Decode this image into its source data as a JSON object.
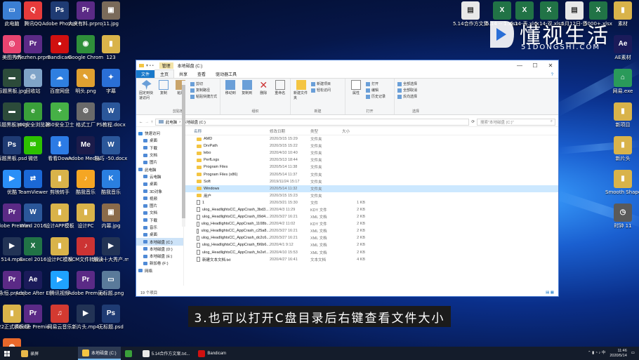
{
  "desktop_left": [
    {
      "label": "此电脑",
      "color": "#3b7fd4",
      "glyph": "▭"
    },
    {
      "label": "腾讯QQ",
      "color": "#e63b3b",
      "glyph": "Q"
    },
    {
      "label": "Adobe Photosh...",
      "color": "#1f3b73",
      "glyph": "Ps"
    },
    {
      "label": "大庆有料.prproj",
      "color": "#5b2a86",
      "glyph": "Pr"
    },
    {
      "label": "11.jpg",
      "color": "#7a6a5a",
      "glyph": "▣"
    },
    {
      "label": "美图秀秀",
      "color": "#e84470",
      "glyph": "◎"
    },
    {
      "label": "zhezhen.prproj",
      "color": "#5b2a86",
      "glyph": "Pr"
    },
    {
      "label": "Bandicam",
      "color": "#d01010",
      "glyph": "●"
    },
    {
      "label": "Google Chrome",
      "color": "#2f8f3a",
      "glyph": "◉"
    },
    {
      "label": "123",
      "color": "#d9b34a",
      "glyph": "▮"
    },
    {
      "label": "标题黑板.jpg",
      "color": "#2c4b3a",
      "glyph": "▬"
    },
    {
      "label": "回收站",
      "color": "#7fa3c8",
      "glyph": "♲"
    },
    {
      "label": "百度网盘",
      "color": "#2f7fe0",
      "glyph": "☁"
    },
    {
      "label": "明头.png",
      "color": "#e0a030",
      "glyph": "✎"
    },
    {
      "label": "字幕",
      "color": "#2a6fd6",
      "glyph": "✦"
    },
    {
      "label": "标题黑板.png",
      "color": "#2c4b3a",
      "glyph": "▬"
    },
    {
      "label": "360安全浏览器",
      "color": "#3aa03a",
      "glyph": "e"
    },
    {
      "label": "360安全卫士",
      "color": "#46b046",
      "glyph": "+"
    },
    {
      "label": "格式工厂",
      "color": "#6a6a6a",
      "glyph": "⚙"
    },
    {
      "label": "PS教程.docx",
      "color": "#2b579a",
      "glyph": "W"
    },
    {
      "label": "标题黑板.psd",
      "color": "#1f3b73",
      "glyph": "Ps"
    },
    {
      "label": "微信",
      "color": "#2dc100",
      "glyph": "✉"
    },
    {
      "label": "看看Down",
      "color": "#2c7be5",
      "glyph": "⬇"
    },
    {
      "label": "Adobe Media...",
      "color": "#1b1b4a",
      "glyph": "Me"
    },
    {
      "label": "技巧 -50.docx",
      "color": "#2b579a",
      "glyph": "W"
    },
    {
      "label": "优酷",
      "color": "#2a8ff7",
      "glyph": "▶"
    },
    {
      "label": "TeamViewer",
      "color": "#1b68d6",
      "glyph": "⇄"
    },
    {
      "label": "剪映转手",
      "color": "#d9b34a",
      "glyph": "▮"
    },
    {
      "label": "酷我音乐",
      "color": "#f5a623",
      "glyph": "♪"
    },
    {
      "label": "酷我音乐",
      "color": "#2a7fe0",
      "glyph": "K"
    },
    {
      "label": "Adobe Premier...",
      "color": "#5b2a86",
      "glyph": "Pr"
    },
    {
      "label": "Word 2016",
      "color": "#2b579a",
      "glyph": "W"
    },
    {
      "label": "设计APP模板",
      "color": "#d9b34a",
      "glyph": "▮"
    },
    {
      "label": "设计PC",
      "color": "#d9b34a",
      "glyph": "▮"
    },
    {
      "label": "内幕.jpg",
      "color": "#8a6a4a",
      "glyph": "▣"
    },
    {
      "label": "514.mp4",
      "color": "#223355",
      "glyph": "▶"
    },
    {
      "label": "Excel 2016",
      "color": "#217346",
      "glyph": "X"
    },
    {
      "label": "设计PC模板",
      "color": "#d9b34a",
      "glyph": "▮"
    },
    {
      "label": "NCM文件转换.exe",
      "color": "#cc3333",
      "glyph": "♪"
    },
    {
      "label": "解读十大秀产.mp4",
      "color": "#223355",
      "glyph": "▶"
    },
    {
      "label": "永恒.prproj",
      "color": "#5b2a86",
      "glyph": "Pr"
    },
    {
      "label": "Adobe After Effects 2020",
      "color": "#1b1b5a",
      "glyph": "Ae"
    },
    {
      "label": "腾讯视频",
      "color": "#1fa2ff",
      "glyph": "▶"
    },
    {
      "label": "Adobe Premier...",
      "color": "#5b2a86",
      "glyph": "Pr"
    },
    {
      "label": "无标题.png",
      "color": "#5a7a9a",
      "glyph": "▭"
    },
    {
      "label": "U22正式模板(更改中搬...",
      "color": "#d9b34a",
      "glyph": "▮"
    },
    {
      "label": "Adobe Premie...",
      "color": "#5b2a86",
      "glyph": "Pr"
    },
    {
      "label": "网易云音乐",
      "color": "#d33a31",
      "glyph": "♫"
    },
    {
      "label": "新片头.mp4",
      "color": "#223355",
      "glyph": "▶"
    },
    {
      "label": "无标题.psd",
      "color": "#1f3b73",
      "glyph": "Ps"
    },
    {
      "label": "Firefox",
      "color": "#e8682a",
      "glyph": "◍"
    }
  ],
  "desktop_right": [
    {
      "label": "5.14合作方文集.txt",
      "color": "#e8e8e8",
      "glyph": "▤"
    },
    {
      "label": "5.14 -- 1.xlsx",
      "color": "#217346",
      "glyph": "X"
    },
    {
      "label": "5.14-表.xlsx",
      "color": "#217346",
      "glyph": "X"
    },
    {
      "label": "5.14-双.xlsx",
      "color": "#217346",
      "glyph": "X"
    },
    {
      "label": "5月12日-音",
      "color": "#e8e8e8",
      "glyph": "▤"
    },
    {
      "label": "5000+.xlsx",
      "color": "#217346",
      "glyph": "X"
    },
    {
      "label": "素材",
      "color": "#d9b34a",
      "glyph": "▮"
    },
    {
      "label": "AE素材",
      "color": "#1b1b5a",
      "glyph": "Ae"
    },
    {
      "label": "网易.exe",
      "color": "#2a9a5a",
      "glyph": "⌂"
    },
    {
      "label": "新项目",
      "color": "#d9b34a",
      "glyph": "▮"
    },
    {
      "label": "新片头",
      "color": "#d9b34a",
      "glyph": "▮"
    },
    {
      "label": "Smooth Shapes ...",
      "color": "#d9b34a",
      "glyph": "▮"
    },
    {
      "label": "时钟 11",
      "color": "#5a5a5a",
      "glyph": "◷"
    }
  ],
  "explorer": {
    "title": "本地磁盘 (C:)",
    "tool_tab": "管理",
    "win_controls": [
      "—",
      "☐",
      "✕"
    ],
    "tabs": [
      "文件",
      "主页",
      "共享",
      "查看",
      "驱动器工具"
    ],
    "ribbon": {
      "pin": "固定到快速访问",
      "copy": "复制",
      "paste": "粘贴",
      "small1": [
        "剪切",
        "复制路径",
        "粘贴快捷方式"
      ],
      "clipboard": "剪贴板",
      "move": "移动到",
      "copyto": "复制到",
      "delete": "删除",
      "rename": "重命名",
      "organize": "组织",
      "newfolder": "新建文件夹",
      "small2": [
        "新建项目",
        "轻松访问"
      ],
      "new": "新建",
      "props": "属性",
      "small3": [
        "打开",
        "编辑",
        "历史记录"
      ],
      "open": "打开",
      "small4": [
        "全部选择",
        "全部取消",
        "反向选择"
      ],
      "select": "选择"
    },
    "breadcrumb": [
      "此电脑",
      "本地磁盘 (C:)"
    ],
    "search_placeholder": "搜索\"本地磁盘 (C:)\"",
    "nav": [
      "快速访问",
      "桌面",
      "下载",
      "文档",
      "图片",
      "此电脑",
      "云电脑",
      "桌面",
      "3D对象",
      "视频",
      "图片",
      "文档",
      "下载",
      "音乐",
      "桌面",
      "本地磁盘 (C:)",
      "本地磁盘 (D:)",
      "本地磁盘 (E:)",
      "新加卷 (F:)",
      "网络"
    ],
    "nav_selected": 15,
    "columns": [
      "名称",
      "修改日期",
      "类型",
      "大小"
    ],
    "files": [
      {
        "name": "AMD",
        "date": "2020/3/15 15:29",
        "type": "文件夹",
        "size": "",
        "kind": "folder"
      },
      {
        "name": "DrvPath",
        "date": "2020/3/15 15:22",
        "type": "文件夹",
        "size": "",
        "kind": "folder"
      },
      {
        "name": "lebo",
        "date": "2020/4/10 10:40",
        "type": "文件夹",
        "size": "",
        "kind": "folder"
      },
      {
        "name": "PerfLogs",
        "date": "2020/3/13 18:44",
        "type": "文件夹",
        "size": "",
        "kind": "folder"
      },
      {
        "name": "Program Files",
        "date": "2020/5/14 11:38",
        "type": "文件夹",
        "size": "",
        "kind": "folder"
      },
      {
        "name": "Program Files (x86)",
        "date": "2020/5/14 11:37",
        "type": "文件夹",
        "size": "",
        "kind": "folder"
      },
      {
        "name": "Soft",
        "date": "2019/11/24 15:17",
        "type": "文件夹",
        "size": "",
        "kind": "folder"
      },
      {
        "name": "Windows",
        "date": "2020/5/14 11:32",
        "type": "文件夹",
        "size": "",
        "kind": "folder"
      },
      {
        "name": "用户",
        "date": "2020/3/15 15:23",
        "type": "文件夹",
        "size": "",
        "kind": "folder"
      },
      {
        "name": "1",
        "date": "2020/3/21 15:30",
        "type": "文件",
        "size": "1 KB",
        "kind": "file"
      },
      {
        "name": "ulog_HeadlightsCC_AppCrash_3bd3...",
        "date": "2020/4/3 11:29",
        "type": "KDY 文件",
        "size": "2 KB",
        "kind": "file"
      },
      {
        "name": "ulog_HeadlightsCC_AppCrash_09d4...",
        "date": "2020/3/27 16:21",
        "type": "XML 文档",
        "size": "2 KB",
        "kind": "file"
      },
      {
        "name": "ulog_HeadlightsCC_AppCrash_1108b...",
        "date": "2020/4/2 11:02",
        "type": "KDY 文件",
        "size": "2 KB",
        "kind": "file"
      },
      {
        "name": "ulog_HeadlightsCC_AppCrash_c25a8...",
        "date": "2020/3/27 16:21",
        "type": "XML 文档",
        "size": "2 KB",
        "kind": "file"
      },
      {
        "name": "ulog_HeadlightsCC_AppCrash_dc2c6...",
        "date": "2020/3/27 16:21",
        "type": "XML 文档",
        "size": "2 KB",
        "kind": "file"
      },
      {
        "name": "ulog_HeadlightsCC_AppCrash_f96b6...",
        "date": "2020/4/1 9:12",
        "type": "XML 文档",
        "size": "2 KB",
        "kind": "file"
      },
      {
        "name": "ulog_HeadlightsCC_AppCrash_fe2ef...",
        "date": "2020/4/10 15:53",
        "type": "XML 文档",
        "size": "2 KB",
        "kind": "file"
      },
      {
        "name": "新建文本文档.txt",
        "date": "2020/4/27 16:41",
        "type": "文本文档",
        "size": "4 KB",
        "kind": "file"
      }
    ],
    "selected_row": 7,
    "status": "19 个项目"
  },
  "subtitle": "3.也可以打开C盘目录后右键查看文件大小",
  "watermark": {
    "main": "懂视生活",
    "sub": "51DONGSHI.COM"
  },
  "taskbar": {
    "items": [
      {
        "label": "录屏",
        "color": "#e8b84a",
        "active": false
      },
      {
        "label": "本地磁盘 (C:)",
        "color": "#f4c542",
        "active": true
      },
      {
        "label": "",
        "color": "#3aa03a",
        "active": false
      },
      {
        "label": "5.14合作方文案.txt...",
        "color": "#e8e8e8",
        "active": false
      },
      {
        "label": "Bandicam",
        "color": "#d01010",
        "active": false
      }
    ],
    "time": "11:46",
    "date": "2020/5/14"
  }
}
